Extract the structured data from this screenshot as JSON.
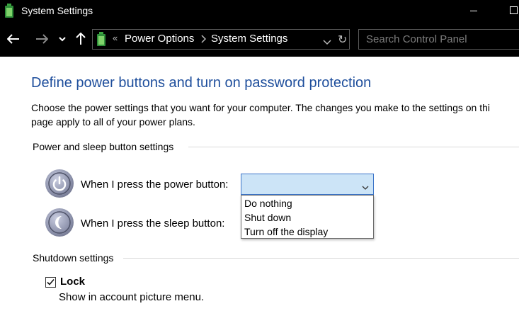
{
  "window": {
    "title": "System Settings",
    "app_icon": "battery-icon"
  },
  "navigation": {
    "back_icon": "back-arrow-icon",
    "forward_icon": "forward-arrow-icon",
    "recent_icon": "chevron-down-icon",
    "up_icon": "up-arrow-icon",
    "breadcrumb_separator": "«",
    "breadcrumb": [
      "Power Options",
      "System Settings"
    ],
    "search_placeholder": "Search Control Panel"
  },
  "page": {
    "heading": "Define power buttons and turn on password protection",
    "description_line1": "Choose the power settings that you want for your computer. The changes you make to the settings on thi",
    "description_line2": "page apply to all of your power plans.",
    "power_section": {
      "label": "Power and sleep button settings",
      "power_button_label": "When I press the power button:",
      "sleep_button_label": "When I press the sleep button:",
      "power_button_value": "",
      "dropdown_options": [
        "Do nothing",
        "Shut down",
        "Turn off the display"
      ]
    },
    "shutdown_section": {
      "label": "Shutdown settings",
      "lock_label": "Lock",
      "lock_checked": true,
      "lock_description": "Show in account picture menu."
    }
  },
  "colors": {
    "heading": "#1e4e9c",
    "dropdown_selected_bg": "#cce4f7",
    "dropdown_border": "#3c74c8",
    "titlebar_bg": "#000000"
  }
}
